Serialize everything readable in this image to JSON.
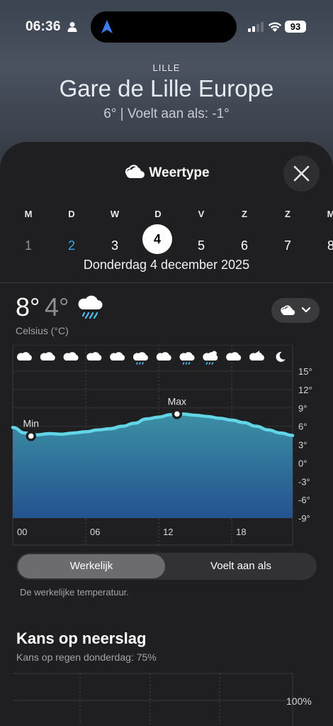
{
  "status": {
    "time": "06:36",
    "battery": "93"
  },
  "location": {
    "city": "LILLE",
    "name": "Gare de Lille Europe",
    "current": "6°  |  Voelt aan als: -1°"
  },
  "sheet": {
    "title": "Weertype",
    "close_label": "Sluiten"
  },
  "days": [
    {
      "letter": "M",
      "num": "1",
      "state": "past"
    },
    {
      "letter": "D",
      "num": "2",
      "state": "today"
    },
    {
      "letter": "W",
      "num": "3",
      "state": "future"
    },
    {
      "letter": "D",
      "num": "4",
      "state": "selected"
    },
    {
      "letter": "V",
      "num": "5",
      "state": "future"
    },
    {
      "letter": "Z",
      "num": "6",
      "state": "future"
    },
    {
      "letter": "Z",
      "num": "7",
      "state": "future"
    },
    {
      "letter": "M",
      "num": "8",
      "state": "future"
    }
  ],
  "selected_date": "Donderdag 4 december 2025",
  "temperature": {
    "high": "8°",
    "low": "4°",
    "unit": "Celsius (°C)"
  },
  "chart_data": {
    "type": "area",
    "x_ticks": [
      "00",
      "06",
      "12",
      "18"
    ],
    "y_ticks": [
      "15°",
      "12°",
      "9°",
      "6°",
      "3°",
      "0°",
      "-3°",
      "-6°",
      "-9°"
    ],
    "ylim": [
      -9,
      15
    ],
    "hours": [
      0,
      1,
      2,
      3,
      4,
      5,
      6,
      7,
      8,
      9,
      10,
      11,
      12,
      13,
      14,
      15,
      16,
      17,
      18,
      19,
      20,
      21,
      22,
      23
    ],
    "series": [
      {
        "values": [
          5.8,
          4.9,
          4.6,
          4.8,
          4.7,
          4.9,
          5.1,
          5.4,
          5.6,
          6.0,
          6.5,
          7.2,
          7.5,
          7.9,
          8.0,
          7.8,
          7.6,
          7.3,
          7.0,
          6.6,
          6.0,
          5.4,
          4.9,
          4.5
        ]
      }
    ],
    "min_label": "Min",
    "max_label": "Max",
    "min_point": {
      "x": 1.5,
      "y": 4.4
    },
    "max_point": {
      "x": 13.5,
      "y": 8.0
    },
    "icons": [
      "cloud-icon",
      "cloud-icon",
      "cloud-icon",
      "cloud-icon",
      "cloud-icon",
      "rain-cloud-icon",
      "cloud-icon",
      "rain-cloud-icon",
      "rain-sun-cloud-icon",
      "cloud-icon",
      "moon-cloud-icon",
      "moon-icon"
    ]
  },
  "segment": {
    "active": "Werkelijk",
    "inactive": "Voelt aan als",
    "description": "De werkelijke temperatuur."
  },
  "precipitation": {
    "title": "Kans op neerslag",
    "subtitle": "Kans op regen donderdag: 75%",
    "tick_top": "100%"
  },
  "colors": {
    "accent": "#37a8ef",
    "line": "#5fd8e6",
    "area_top": "#3a8fa3",
    "area_bottom": "#245a95",
    "sheet": "#1f1f21"
  }
}
